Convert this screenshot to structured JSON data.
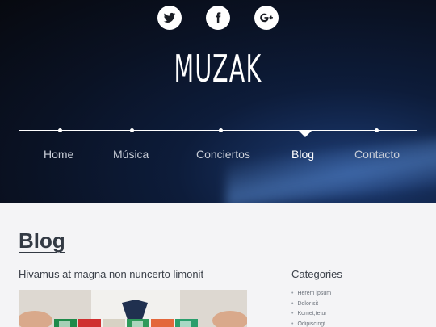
{
  "header": {
    "logo": "MUZAK",
    "social": [
      {
        "icon": "twitter-icon"
      },
      {
        "icon": "facebook-icon"
      },
      {
        "icon": "google-plus-icon"
      }
    ],
    "nav": [
      {
        "label": "Home",
        "active": false
      },
      {
        "label": "Música",
        "active": false
      },
      {
        "label": "Conciertos",
        "active": false
      },
      {
        "label": "Blog",
        "active": true
      },
      {
        "label": "Contacto",
        "active": false
      }
    ]
  },
  "main": {
    "page_title": "Blog",
    "post": {
      "title": "Hivamus at magna non nuncerto limonit"
    }
  },
  "sidebar": {
    "title": "Categories",
    "items": [
      "Herem ipsum",
      "Dolor sit",
      "Komet,tetur",
      "Odipiscingt"
    ]
  },
  "colors": {
    "hero_dark": "#07090f",
    "hero_blue": "#1c3b73",
    "page_bg": "#f4f4f6",
    "text": "#333a44"
  }
}
